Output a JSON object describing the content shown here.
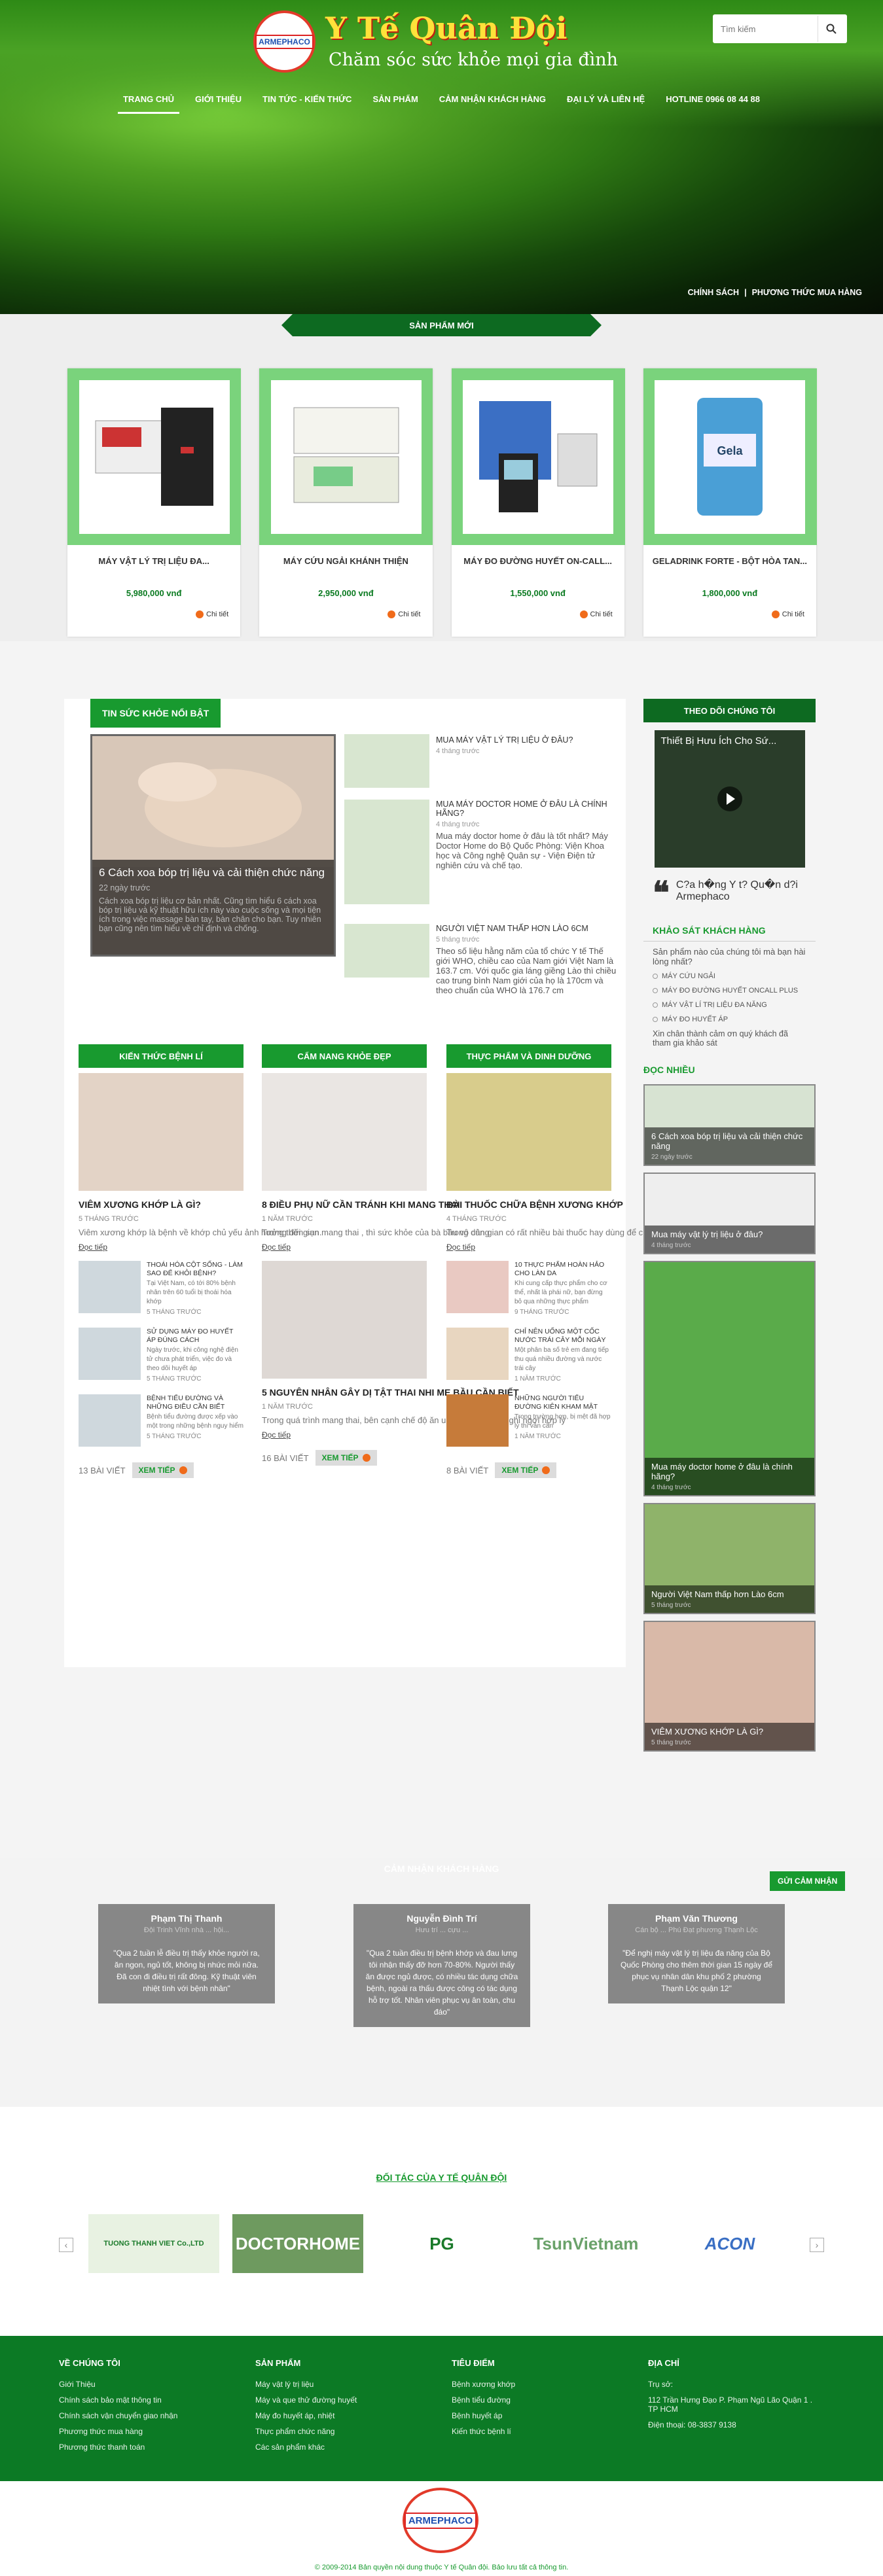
{
  "header": {
    "logo_mark": "ARMEPHACO",
    "title": "Y Tế Quân Đội",
    "slogan": "Chăm sóc sức khỏe mọi gia đình",
    "search_placeholder": "Tìm kiếm",
    "nav": [
      "TRANG CHỦ",
      "GIỚI THIỆU",
      "TIN TỨC - KIẾN THỨC",
      "SẢN PHẨM",
      "CẢM NHẬN KHÁCH HÀNG",
      "ĐẠI LÝ VÀ LIÊN HỆ",
      "HOTLINE 0966 08 44 88"
    ],
    "sub_links": [
      "CHÍNH SÁCH",
      "PHƯƠNG THỨC MUA HÀNG"
    ]
  },
  "new_products": {
    "title": "SẢN PHẨM MỚI",
    "items": [
      {
        "name": "MÁY VẬT LÝ TRỊ LIỆU ĐA...",
        "price": "5,980,000 vnđ",
        "detail": "Chi tiết"
      },
      {
        "name": "MÁY CỨU NGẢI KHÁNH THIỆN",
        "price": "2,950,000 vnđ",
        "detail": "Chi tiết"
      },
      {
        "name": "MÁY ĐO ĐƯỜNG HUYẾT ON-CALL...",
        "price": "1,550,000 vnđ",
        "detail": "Chi tiết"
      },
      {
        "name": "GELADRINK FORTE - BỘT HÒA TAN...",
        "price": "1,800,000 vnđ",
        "detail": "Chi tiết"
      }
    ]
  },
  "hot_news": {
    "title": "TIN SỨC KHỎE NỔI BẬT",
    "main": {
      "title": "6 Cách xoa bóp trị liệu và cải thiện chức năng",
      "time": "22 ngày trước",
      "text": "Cách xoa bóp trị liệu cơ bản nhất. Cũng tìm hiểu 6 cách xoa bóp trị liệu và kỹ thuật hữu ích này vào cuộc sống và mọi tiện ích trong việc massage bàn tay, bàn chân cho bạn. Tuy nhiên bạn cũng nên tìm hiểu về chỉ định và chống."
    },
    "list": [
      {
        "title": "MUA MÁY VẬT LÝ TRỊ LIỆU Ở ĐÂU?",
        "time": "4 tháng trước",
        "text": ""
      },
      {
        "title": "MUA MÁY DOCTOR HOME Ở ĐÂU LÀ CHÍNH HÃNG?",
        "time": "4 tháng trước",
        "text": "Mua máy doctor home ở đâu là tốt nhất? Máy Doctor Home do Bộ Quốc Phòng: Viện Khoa học và Công nghệ Quân sự - Viện Điện tử nghiên cứu và chế tạo."
      },
      {
        "title": "NGƯỜI VIỆT NAM THẤP HƠN LÀO 6CM",
        "time": "5 tháng trước",
        "text": "Theo số liệu hằng năm của tổ chức Y tế Thế giới WHO, chiều cao của Nam giới Việt Nam là 163.7 cm. Với quốc gia láng giềng Lào thì chiều cao trung bình Nam giới của họ là 170cm và theo chuẩn của WHO là 176.7 cm"
      }
    ]
  },
  "columns": [
    {
      "title": "KIẾN THỨC BỆNH LÍ",
      "main_title": "VIÊM XƯƠNG KHỚP LÀ GÌ?",
      "main_time": "5 THÁNG TRƯỚC",
      "main_text": "Viêm xương khớp là bệnh về khớp chủ yếu ảnh hưởng đến sụn.",
      "read_more": "Đọc tiếp",
      "minis": [
        {
          "title": "THOÁI HÓA CỘT SỐNG - LÀM SAO ĐỂ KHỎI BỆNH?",
          "text": "Tại Việt Nam, có tới 80% bệnh nhân trên 60 tuổi bị thoái hóa khớp",
          "time": "5 THÁNG TRƯỚC",
          "read": "Đọc tiếp"
        },
        {
          "title": "SỬ DỤNG MÁY ĐO HUYẾT ÁP ĐÚNG CÁCH",
          "text": "Ngày trước, khi công nghệ điện tử chưa phát triển, việc đo và theo dõi huyết áp",
          "time": "5 THÁNG TRƯỚC",
          "read": "Đọc tiếp"
        },
        {
          "title": "BỆNH TIỂU ĐƯỜNG VÀ NHỮNG ĐIỀU CẦN BIẾT",
          "text": "Bệnh tiểu đường được xếp vào một trong những bệnh nguy hiểm",
          "time": "5 THÁNG TRƯỚC",
          "read": "Đọc tiếp"
        }
      ],
      "count": "13 BÀI VIẾT",
      "more": "XEM TIẾP"
    },
    {
      "title": "CẨM NANG KHỎE ĐẸP",
      "main_title": "8 ĐIỀU PHỤ NỮ CẦN TRÁNH KHI MANG THAI",
      "main_time": "1 NĂM TRƯỚC",
      "main_text": "Trong thời gian mang thai , thì sức khỏe của bà bầu vô cùng",
      "read_more": "Đọc tiếp",
      "second_title": "5 NGUYÊN NHÂN GÂY DỊ TẬT THAI NHI MẸ BẦU CẦN BIẾT",
      "second_time": "1 NĂM TRƯỚC",
      "second_text": "Trong quá trình mang thai, bên cạnh chế độ ăn uống, sinh hoạt, nghỉ ngơi hợp lý",
      "second_read": "Đọc tiếp",
      "count": "16 BÀI VIẾT",
      "more": "XEM TIẾP"
    },
    {
      "title": "THỰC PHẨM VÀ DINH DƯỠNG",
      "main_title": "BÀI THUỐC CHỮA BỆNH XƯƠNG KHỚP",
      "main_time": "4 THÁNG TRƯỚC",
      "main_text": "Trong dân gian có rất nhiều bài thuốc hay dùng để chữa bệnh gout",
      "read_more": "Đọc tiếp",
      "minis": [
        {
          "title": "10 thực phẩm hoàn hảo cho làn da",
          "text": "Khi cung cấp thực phẩm cho cơ thể, nhất là phái nữ, bạn đừng bỏ qua những thực phẩm",
          "time": "9 THÁNG TRƯỚC",
          "read": "Đọc tiếp"
        },
        {
          "title": "Chỉ nên uống một cốc nước trái cây mỗi ngày",
          "text": "Một phân ba số trẻ em đang tiếp thu quá nhiều đường và nước trái cây",
          "time": "1 NĂM TRƯỚC",
          "read": "Đọc tiếp"
        },
        {
          "title": "NHỮNG NGƯỜI TIỂU ĐƯỜNG KIÊN KHAM MẬT",
          "text": "Trong trường hợp, bị mệt đã hợp lý thì vẫn cần",
          "time": "1 NĂM TRƯỚC",
          "read": "Đọc tiếp"
        }
      ],
      "count": "8 BÀI VIẾT",
      "more": "XEM TIẾP"
    }
  ],
  "sidebar": {
    "follow_title": "THEO DÕI CHÚNG TÔI",
    "video_title": "Thiết Bị Hưu Ích Cho Sứ...",
    "quote": "C?a h�ng Y t? Qu�n d?i Armephaco",
    "survey_title": "KHẢO SÁT KHÁCH HÀNG",
    "survey_q": "Sản phẩm nào của chúng tôi mà bạn hài lòng nhất?",
    "options": [
      "MÁY CỨU NGẢI",
      "MÁY ĐO ĐƯỜNG HUYẾT ONCALL PLUS",
      "MÁY VẬT LÍ TRỊ LIỆU ĐA NĂNG",
      "MÁY ĐO HUYẾT ÁP"
    ],
    "survey_note": "Xin chân thành cảm ơn quý khách đã tham gia khảo sát",
    "popular_title": "ĐỌC NHIỀU",
    "popular": [
      {
        "title": "6 Cách xoa bóp trị liệu và cải thiện chức năng",
        "time": "22 ngày trước"
      },
      {
        "title": "Mua máy vật lý trị liệu ở đâu?",
        "time": "4 tháng trước"
      },
      {
        "title": "Mua máy doctor home ở đâu là chính hãng?",
        "time": "4 tháng trước"
      },
      {
        "title": "Người Việt Nam thấp hơn Lào 6cm",
        "time": "5 tháng trước"
      },
      {
        "title": "VIÊM XƯƠNG KHỚP LÀ GÌ?",
        "time": "5 tháng trước"
      }
    ]
  },
  "testimonials": {
    "title": "CẢM NHẬN KHÁCH HÀNG",
    "send": "GỬI CẢM NHẬN",
    "items": [
      {
        "name": "Phạm Thị Thanh",
        "role": "Đội Trinh Vĩnh nhà ... hội...",
        "text": "\"Qua 2 tuần lễ điều trị thấy khỏe người ra, ăn ngon, ngủ tốt, không bị nhức mỏi nữa. Đã con đi điều trị rất đông. Kỹ thuật viên nhiệt tình với bệnh nhân\""
      },
      {
        "name": "Nguyễn Đình Trí",
        "role": "Hưu trí ... cựu ...",
        "text": "\"Qua 2 tuần điều trị bệnh khớp và đau lưng tôi nhận thấy đỡ hơn 70-80%. Người thấy ăn được ngủ được, có nhiều tác dụng chữa bệnh, ngoài ra thấu được công có tác dụng hỗ trợ tốt. Nhân viên phục vụ ân toàn, chu đáo\""
      },
      {
        "name": "Phạm Văn Thương",
        "role": "Cán bộ ... Phú Đạt phương Thạnh Lộc",
        "text": "\"Để nghị máy vật lý trị liệu đa năng của Bộ Quốc Phòng cho thêm thời gian 15 ngày để phục vụ nhân dân khu phố 2 phường Thạnh Lộc quận 12\""
      }
    ]
  },
  "partners": {
    "title": "ĐỐI TÁC CỦA Y TẾ QUÂN ĐỘI",
    "items": [
      "TUONG THANH VIET Co.,LTD",
      "DOCTORHOME",
      "PG",
      "TsunVietnam",
      "ACON"
    ]
  },
  "footer": {
    "cols": [
      {
        "title": "VỀ CHÚNG TÔI",
        "links": [
          "Giới Thiệu",
          "Chính sách bảo mật thông tin",
          "Chính sách vận chuyển giao nhận",
          "Phương thức mua hàng",
          "Phương thức thanh toán"
        ]
      },
      {
        "title": "SẢN PHẨM",
        "links": [
          "Máy vật lý trị liệu",
          "Máy và que thử đường huyết",
          "Máy đo huyết áp, nhiệt",
          "Thực phẩm chức năng",
          "Các sản phẩm khác"
        ]
      },
      {
        "title": "TIÊU ĐIỂM",
        "links": [
          "Bệnh xương khớp",
          "Bệnh tiểu đường",
          "Bệnh huyết áp",
          "Kiến thức bệnh lí"
        ]
      },
      {
        "title": "ĐỊA CHỈ",
        "links": [
          "Trụ sở:",
          "112 Trần Hưng Đạo P.  Phạm Ngũ Lão Quận 1 . TP HCM",
          "Điện thoại: 08-3837 9138"
        ]
      }
    ],
    "copyright": "© 2009-2014 Bản quyền nội dung thuộc Y tế Quân đội. Bảo lưu tất cả thông tin."
  }
}
